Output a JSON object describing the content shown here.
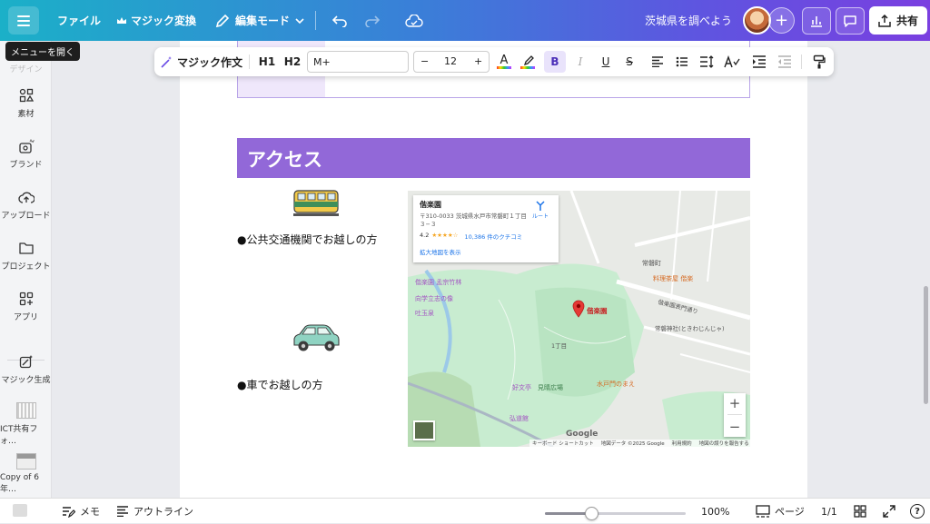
{
  "topbar": {
    "file_label": "ファイル",
    "magic_switch_label": "マジック変換",
    "edit_mode_label": "編集モード",
    "doc_title": "茨城県を調べよう",
    "share_label": "共有"
  },
  "tooltip": {
    "menu_open": "メニューを開く"
  },
  "sidebar": {
    "partial_top_label": "デザイン",
    "items": [
      {
        "label": "素材",
        "icon": "shapes-icon"
      },
      {
        "label": "ブランド",
        "icon": "brand-icon"
      },
      {
        "label": "アップロード",
        "icon": "upload-icon"
      },
      {
        "label": "プロジェクト",
        "icon": "folder-icon"
      },
      {
        "label": "アプリ",
        "icon": "apps-icon"
      },
      {
        "label": "マジック生成",
        "icon": "magic-generate-icon"
      },
      {
        "label": "ICT共有フォ…",
        "icon": "thumbnail-icon"
      },
      {
        "label": "Copy of 6年…",
        "icon": "thumbnail-icon"
      }
    ]
  },
  "format_toolbar": {
    "magic_write_label": "マジック作文",
    "h1_label": "H1",
    "h2_label": "H2",
    "font_name": "M+",
    "font_size": "12",
    "minus_label": "−",
    "plus_label": "+",
    "bold_label": "B",
    "italic_label": "I",
    "underline_label": "U",
    "strike_label": "S"
  },
  "document": {
    "section_heading": "アクセス",
    "public_transport_text": "●公共交通機関でお越しの方",
    "car_text": "●車でお越しの方"
  },
  "map": {
    "place_name": "偕楽園",
    "address": "〒310-0033 茨城県水戸市常磐町１丁目３−３",
    "rating": "4.2",
    "stars": "★★★★☆",
    "reviews": "10,386 件のクチコミ",
    "directions_label": "ルート",
    "larger_map_link": "拡大地図を表示",
    "pin_label": "偕楽園",
    "labels": [
      "偕楽園 孟宗竹林",
      "向学立志の像",
      "吐玉泉",
      "見晴広場",
      "好文亭",
      "常磐町",
      "料理茶屋 偕楽",
      "常磐神社(ときわじんじゃ)",
      "偕楽園表門通り",
      "水戸門のまえ",
      "弘道館",
      "1丁目"
    ],
    "google_label": "Google",
    "footer_shortcuts": "キーボード ショートカット",
    "footer_mapdata": "地図データ ©2025 Google",
    "footer_terms": "利用規約",
    "footer_report": "地図の誤りを報告する",
    "zoom_in": "+",
    "zoom_out": "−"
  },
  "bottombar": {
    "notes_label": "メモ",
    "outline_label": "アウトライン",
    "zoom_level": "100%",
    "zoom_fraction": 0.33,
    "pages_label": "ページ",
    "page_count": "1/1",
    "help_label": "?"
  },
  "colors": {
    "heading_bar": "#9268d8",
    "topbar_start": "#1bb0c8",
    "topbar_end": "#7a3fe0"
  }
}
